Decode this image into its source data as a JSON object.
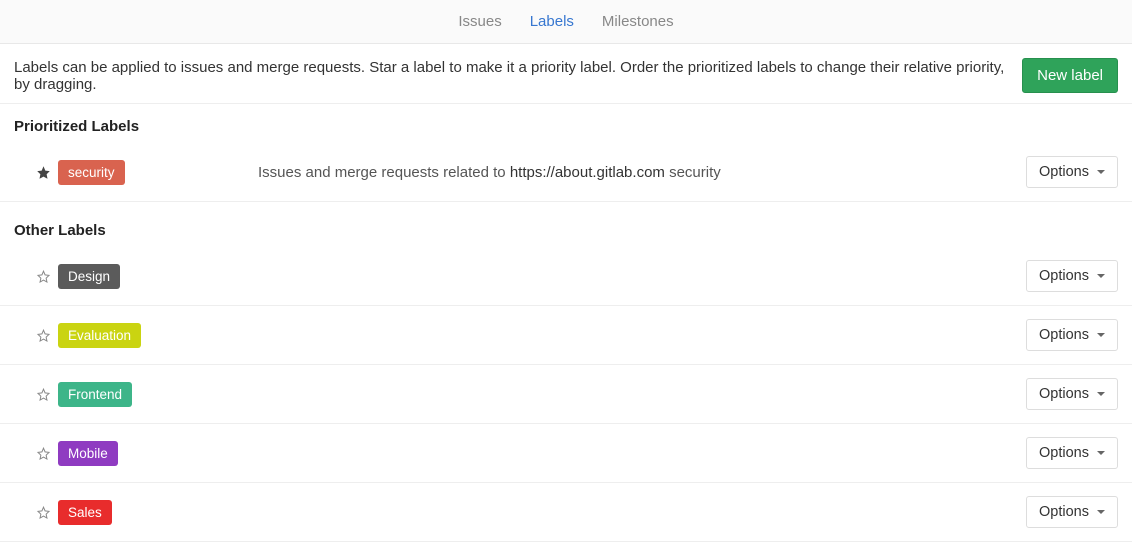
{
  "tabs": {
    "issues": "Issues",
    "labels": "Labels",
    "milestones": "Milestones"
  },
  "header": {
    "help": "Labels can be applied to issues and merge requests. Star a label to make it a priority label. Order the prioritized labels to change their relative priority, by dragging.",
    "new_label": "New label"
  },
  "sections": {
    "prioritized_title": "Prioritized Labels",
    "other_title": "Other Labels"
  },
  "prioritized": [
    {
      "name": "security",
      "color": "#d9634f",
      "desc_prefix": "Issues and merge requests related to ",
      "desc_link": "https://about.gitlab.com",
      "desc_suffix": " security",
      "options": "Options"
    }
  ],
  "other": [
    {
      "name": "Design",
      "color": "#5b5b5b",
      "options": "Options"
    },
    {
      "name": "Evaluation",
      "color": "#cad411",
      "options": "Options"
    },
    {
      "name": "Frontend",
      "color": "#3db589",
      "options": "Options"
    },
    {
      "name": "Mobile",
      "color": "#8f3bc1",
      "options": "Options"
    },
    {
      "name": "Sales",
      "color": "#e82c2c",
      "options": "Options"
    }
  ]
}
